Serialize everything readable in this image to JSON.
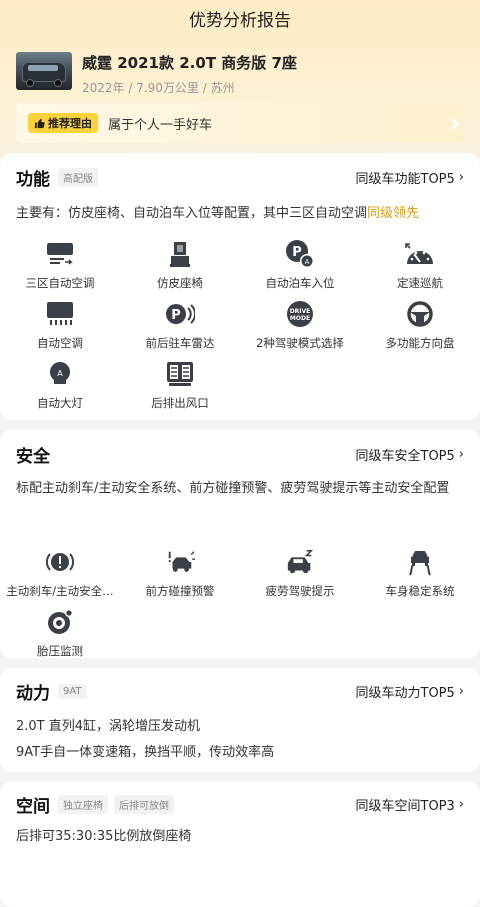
{
  "page": {
    "title": "优势分析报告"
  },
  "car": {
    "name": "威霆 2021款 2.0T 商务版 7座",
    "meta": "2022年 / 7.90万公里 / 苏州"
  },
  "recommend": {
    "badge": "推荐理由",
    "text": "属于个人一手好车"
  },
  "function": {
    "title": "功能",
    "tag": "高配版",
    "top_link": "同级车功能TOP5",
    "desc_prefix": "主要有：仿皮座椅、自动泊车入位等配置，其中三区自动空调",
    "desc_highlight": "同级领先",
    "items": [
      {
        "label": "三区自动空调",
        "icon": "ac-panel-icon"
      },
      {
        "label": "仿皮座椅",
        "icon": "seat-icon"
      },
      {
        "label": "自动泊车入位",
        "icon": "auto-park-icon"
      },
      {
        "label": "定速巡航",
        "icon": "cruise-gauge-icon"
      },
      {
        "label": "自动空调",
        "icon": "auto-ac-icon"
      },
      {
        "label": "前后驻车雷达",
        "icon": "parking-radar-icon"
      },
      {
        "label": "2种驾驶模式选择",
        "icon": "drive-mode-icon"
      },
      {
        "label": "多功能方向盘",
        "icon": "steering-wheel-icon"
      },
      {
        "label": "自动大灯",
        "icon": "auto-headlight-icon"
      },
      {
        "label": "后排出风口",
        "icon": "rear-vent-icon"
      }
    ]
  },
  "safety": {
    "title": "安全",
    "top_link": "同级车安全TOP5",
    "desc": "标配主动刹车/主动安全系统、前方碰撞预警、疲劳驾驶提示等主动安全配置",
    "items": [
      {
        "label": "主动刹车/主动安全…",
        "icon": "brake-warning-icon"
      },
      {
        "label": "前方碰撞预警",
        "icon": "collision-warning-icon"
      },
      {
        "label": "疲劳驾驶提示",
        "icon": "fatigue-icon"
      },
      {
        "label": "车身稳定系统",
        "icon": "stability-icon"
      },
      {
        "label": "胎压监测",
        "icon": "tire-pressure-icon"
      }
    ]
  },
  "power": {
    "title": "动力",
    "tag": "9AT",
    "top_link": "同级车动力TOP5",
    "lines": [
      "2.0T 直列4缸，涡轮增压发动机",
      "9AT手自一体变速箱，换挡平顺，传动效率高"
    ]
  },
  "space": {
    "title": "空间",
    "tags": [
      "独立座椅",
      "后排可放倒"
    ],
    "top_link": "同级车空间TOP3",
    "desc": "后排可35:30:35比例放倒座椅"
  },
  "colors": {
    "accent": "#d8a11a",
    "badge": "#ffd13b",
    "icon": "#3b3f47"
  }
}
